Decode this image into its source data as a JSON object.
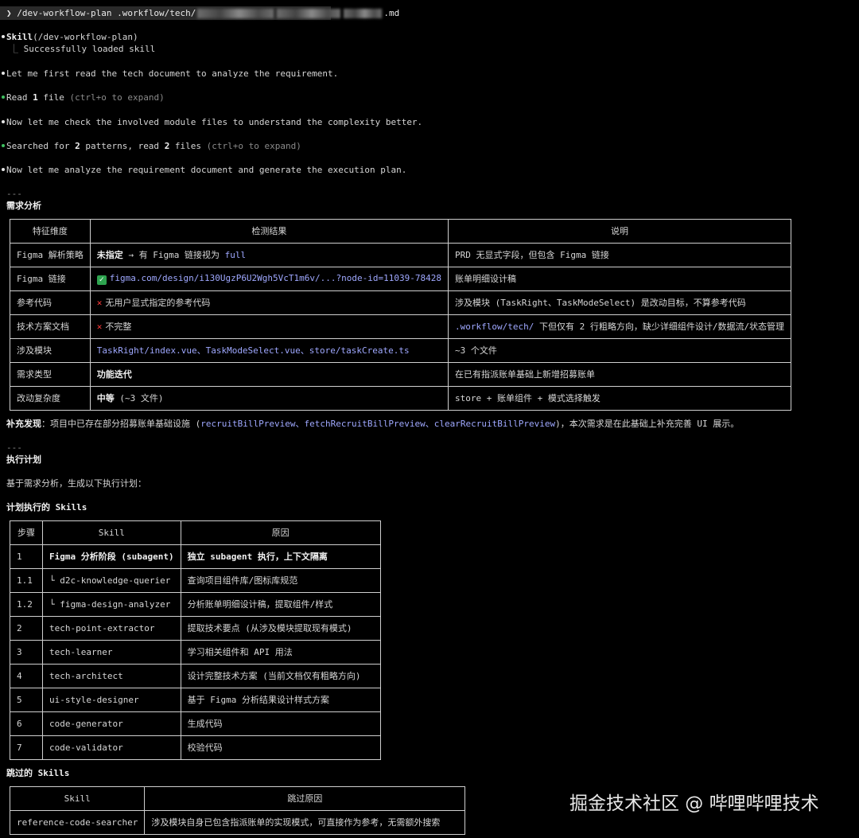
{
  "prompt": {
    "symbol": "❯",
    "command": "/dev-workflow-plan .workflow/tech/",
    "suffix": ".md"
  },
  "skill_block": {
    "name": "Skill",
    "arg": "(/dev-workflow-plan)",
    "tree": "⎿",
    "status": "Successfully loaded skill"
  },
  "messages": {
    "m1": "Let me first read the tech document to analyze the requirement.",
    "m2_pre": "Read ",
    "m2_num": "1",
    "m2_post": " file ",
    "m2_hint": "(ctrl+o to expand)",
    "m3": "Now let me check the involved module files to understand the complexity better.",
    "m4_pre": "Searched for ",
    "m4_num1": "2",
    "m4_mid": " patterns, read ",
    "m4_num2": "2",
    "m4_post": " files ",
    "m4_hint": "(ctrl+o to expand)",
    "m5": "Now let me analyze the requirement document and generate the execution plan."
  },
  "separator": "---",
  "analysis": {
    "heading": "需求分析",
    "headers": [
      "特征维度",
      "检测结果",
      "说明"
    ],
    "rows": [
      {
        "dim": "Figma 解析策略",
        "res_bold": "未指定",
        "res_arrow": " → 有 Figma 链接视为 ",
        "res_code": "full",
        "note": "PRD 无显式字段，但包含 Figma 链接"
      },
      {
        "dim": "Figma 链接",
        "res_icon": "✓",
        "res_code": "figma.com/design/i130UgzP6U2Wgh5VcT1m6v/...?node-id=11039-78428",
        "note": "账单明细设计稿"
      },
      {
        "dim": "参考代码",
        "res_icon": "✕",
        "res_text": "无用户显式指定的参考代码",
        "note": "涉及模块 (TaskRight、TaskModeSelect) 是改动目标，不算参考代码"
      },
      {
        "dim": "技术方案文档",
        "res_icon": "✕",
        "res_text": "不完整",
        "note_code": ".workflow/tech/",
        "note": " 下但仅有 2 行粗略方向，缺少详细组件设计/数据流/状态管理"
      },
      {
        "dim": "涉及模块",
        "res_code": "TaskRight/index.vue、TaskModeSelect.vue、store/taskCreate.ts",
        "note": "~3 个文件"
      },
      {
        "dim": "需求类型",
        "res_bold": "功能迭代",
        "note": "在已有指派账单基础上新增招募账单"
      },
      {
        "dim": "改动复杂度",
        "res_bold": "中等",
        "res_text": " (~3 文件)",
        "note": "store + 账单组件 + 模式选择触发"
      }
    ],
    "supplement_label": "补充发现",
    "supplement_pre": "：项目中已存在部分招募账单基础设施 (",
    "supplement_code": "recruitBillPreview、fetchRecruitBillPreview、clearRecruitBillPreview",
    "supplement_post": ")，本次需求是在此基础上补充完善 UI 展示。"
  },
  "plan": {
    "heading": "执行计划",
    "intro": "基于需求分析，生成以下执行计划：",
    "skills_heading": "计划执行的 Skills",
    "headers": [
      "步骤",
      "Skill",
      "原因"
    ],
    "rows": [
      {
        "step": "1",
        "skill": "Figma 分析阶段 (subagent)",
        "reason": "独立 subagent 执行，上下文隔离",
        "bold": true
      },
      {
        "step": "1.1",
        "skill": "└ d2c-knowledge-querier",
        "reason": "查询项目组件库/图标库规范"
      },
      {
        "step": "1.2",
        "skill": "└ figma-design-analyzer",
        "reason": "分析账单明细设计稿，提取组件/样式"
      },
      {
        "step": "2",
        "skill": "tech-point-extractor",
        "reason": "提取技术要点 (从涉及模块提取现有模式)"
      },
      {
        "step": "3",
        "skill": "tech-learner",
        "reason": "学习相关组件和 API 用法"
      },
      {
        "step": "4",
        "skill": "tech-architect",
        "reason": "设计完整技术方案 (当前文档仅有粗略方向)"
      },
      {
        "step": "5",
        "skill": "ui-style-designer",
        "reason": "基于 Figma 分析结果设计样式方案"
      },
      {
        "step": "6",
        "skill": "code-generator",
        "reason": "生成代码"
      },
      {
        "step": "7",
        "skill": "code-validator",
        "reason": "校验代码"
      }
    ],
    "skipped_heading": "跳过的 Skills",
    "skipped_headers": [
      "Skill",
      "跳过原因"
    ],
    "skipped_rows": [
      {
        "skill": "reference-code-searcher",
        "reason": "涉及模块自身已包含指派账单的实现模式，可直接作为参考，无需额外搜索"
      }
    ]
  },
  "watermark": "掘金技术社区 @ 哔哩哔哩技术",
  "colors": {
    "background": "#000000",
    "text": "#d6d6d6",
    "code": "#9fa8ff",
    "bullet_green": "#3fc060",
    "cross_red": "#ff3b3b",
    "check_green": "#2ea44f"
  }
}
